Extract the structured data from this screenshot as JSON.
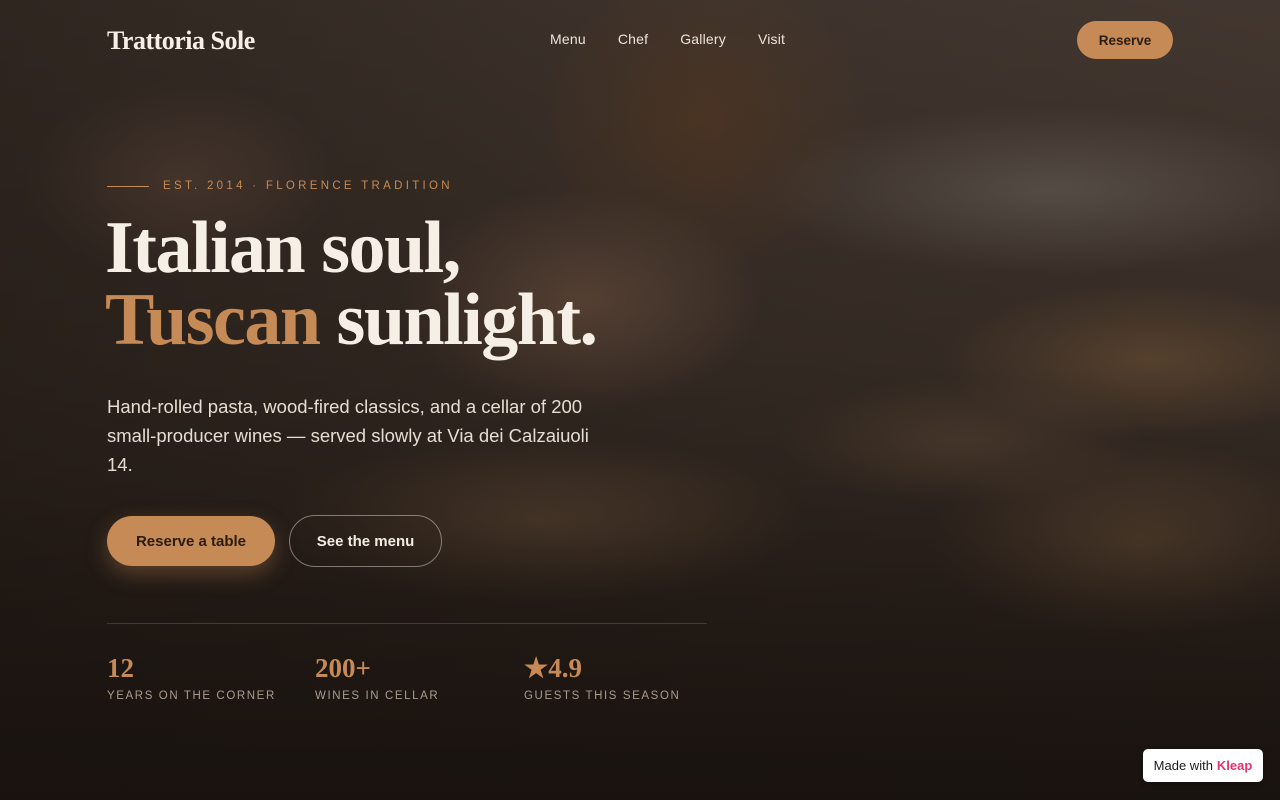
{
  "header": {
    "logo": "Trattoria Sole",
    "nav": [
      "Menu",
      "Chef",
      "Gallery",
      "Visit"
    ],
    "reserve_label": "Reserve"
  },
  "hero": {
    "eyebrow": "EST. 2014 · FLORENCE TRADITION",
    "headline_line1": "Italian soul,",
    "headline_accent": "Tuscan",
    "headline_rest": " sunlight.",
    "lede": "Hand-rolled pasta, wood-fired classics, and a cellar of 200 small-producer wines — served slowly at Via dei Calzaiuoli 14.",
    "cta_primary": "Reserve a table",
    "cta_secondary": "See the menu"
  },
  "stats": [
    {
      "value": "12",
      "label": "YEARS ON THE CORNER"
    },
    {
      "value": "200+",
      "label": "WINES IN CELLAR"
    },
    {
      "value": "★4.9",
      "label": "GUESTS THIS SEASON"
    }
  ],
  "badge": {
    "prefix": "Made with",
    "brand": "Kleap"
  },
  "colors": {
    "accent": "#c58a55",
    "text": "#f6efe6",
    "badge_brand": "#e5336d"
  }
}
